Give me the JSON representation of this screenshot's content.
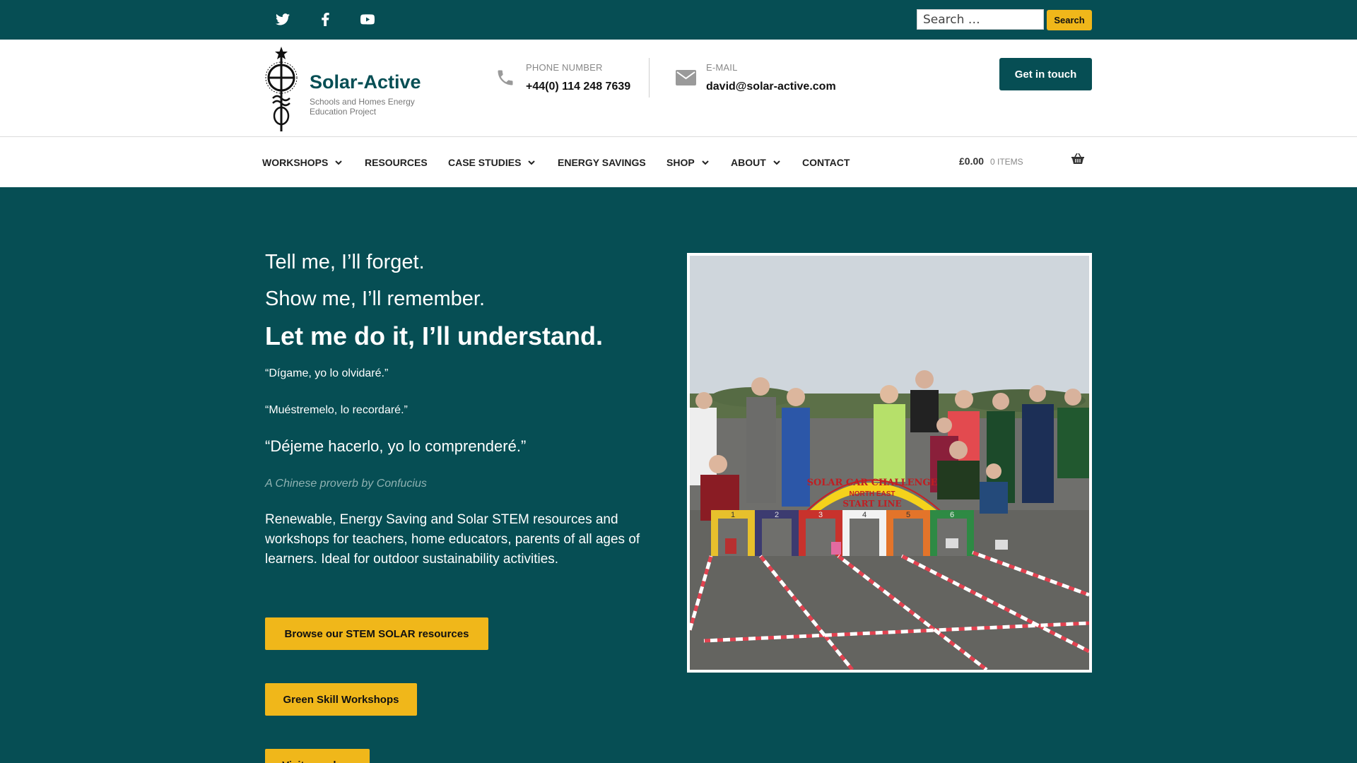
{
  "topbar": {
    "social": [
      {
        "name": "twitter-icon"
      },
      {
        "name": "facebook-icon"
      },
      {
        "name": "youtube-icon"
      }
    ],
    "search_placeholder": "Search …",
    "search_button": "Search"
  },
  "header": {
    "site_title": "Solar-Active",
    "tagline": "Schools and Homes Energy Education Project",
    "phone_label": "PHONE NUMBER",
    "phone_value": "+44(0) 114 248 7639",
    "email_label": "E-MAIL",
    "email_value": "david@solar-active.com",
    "cta": "Get in touch"
  },
  "nav": {
    "items": [
      {
        "label": "WORKSHOPS",
        "has_dropdown": true
      },
      {
        "label": "RESOURCES",
        "has_dropdown": false
      },
      {
        "label": "CASE STUDIES",
        "has_dropdown": true
      },
      {
        "label": "ENERGY SAVINGS",
        "has_dropdown": false
      },
      {
        "label": "SHOP",
        "has_dropdown": true
      },
      {
        "label": "ABOUT",
        "has_dropdown": true
      },
      {
        "label": "CONTACT",
        "has_dropdown": false
      }
    ],
    "cart_total": "£0.00",
    "cart_count": "0 ITEMS"
  },
  "hero": {
    "line1": "Tell me, I’ll forget.",
    "line2": "Show me, I’ll remember.",
    "line3": "Let me do it, I’ll understand.",
    "es1": "“Dígame, yo lo olvidaré.”",
    "es2": "“Muéstremelo, lo recordaré.”",
    "es3": "“Déjeme hacerlo, yo lo comprenderé.”",
    "attribution": "A Chinese proverb by Confucius",
    "description": "Renewable, Energy Saving and Solar STEM resources and workshops for teachers, home educators, parents of all ages of learners. Ideal for outdoor sustainability activities.",
    "buttons": [
      "Browse our STEM SOLAR resources",
      "Green Skill Workshops",
      "Visit our shop"
    ],
    "photo": {
      "arch_line1": "SOLAR CAR CHALLENGE",
      "arch_line2": "NORTH EAST",
      "arch_line3": "START LINE",
      "lanes": [
        "1",
        "2",
        "3",
        "4",
        "5",
        "6"
      ]
    }
  },
  "colors": {
    "brand_teal": "#064e54",
    "accent_yellow": "#f0b71a"
  }
}
